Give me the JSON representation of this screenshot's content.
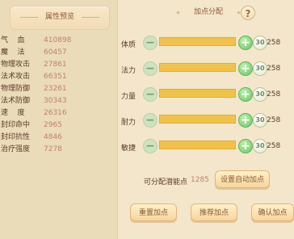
{
  "left_panel": {
    "title": "属性预览",
    "stats": [
      {
        "label": "气    血",
        "value": "410898"
      },
      {
        "label": "魔    法",
        "value": "60457"
      },
      {
        "label": "物理攻击",
        "value": "27861"
      },
      {
        "label": "法术攻击",
        "value": "66351"
      },
      {
        "label": "物理防御",
        "value": "23261"
      },
      {
        "label": "法术防御",
        "value": "30343"
      },
      {
        "label": "速    度",
        "value": "26316"
      },
      {
        "label": "封印命中",
        "value": "2965"
      },
      {
        "label": "封印抗性",
        "value": "4846"
      },
      {
        "label": "治疗强度",
        "value": "7278"
      }
    ]
  },
  "right_panel": {
    "title": "加点分配",
    "help_icon": "?",
    "attributes": [
      {
        "label": "体质",
        "badge": "30",
        "value": "258"
      },
      {
        "label": "法力",
        "badge": "30",
        "value": "258"
      },
      {
        "label": "力量",
        "badge": "30",
        "value": "258"
      },
      {
        "label": "耐力",
        "badge": "30",
        "value": "258"
      },
      {
        "label": "敏捷",
        "badge": "30",
        "value": "258"
      }
    ],
    "free_points_label": "可分配潜能点",
    "free_points_value": "1285",
    "buttons": {
      "auto": "设置自动加点",
      "reset": "重置加点",
      "recommend": "推荐加点",
      "confirm": "确认加点"
    }
  },
  "icons": {
    "minus": "−",
    "plus": "+"
  }
}
